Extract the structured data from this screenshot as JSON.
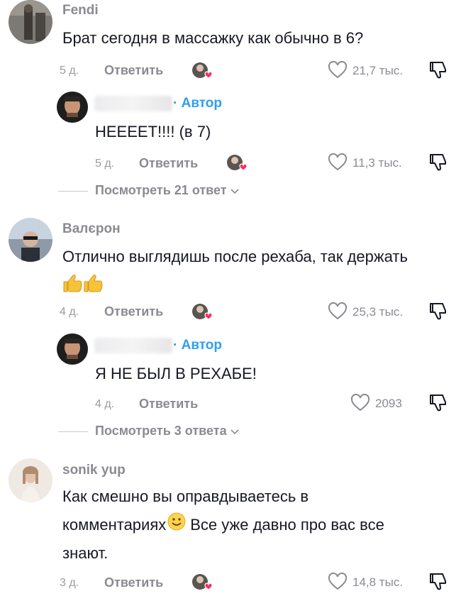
{
  "comments": [
    {
      "author": "Fendi",
      "text": "Брат сегодня в массажку как обычно в 6?",
      "date": "5 д.",
      "reply_label": "Ответить",
      "likes": "21,7 тыс.",
      "reply": {
        "author_tag": "· Автор",
        "text": "НЕЕЕЕТ!!!! (в 7)",
        "date": "5 д.",
        "reply_label": "Ответить",
        "likes": "11,3 тыс."
      },
      "view_replies": "Посмотреть 21 ответ"
    },
    {
      "author": "Валєрон",
      "text": "Отлично выглядишь после рехаба, так держать",
      "date": "4 д.",
      "reply_label": "Ответить",
      "likes": "25,3 тыс.",
      "reply": {
        "author_tag": "· Автор",
        "text": "Я НЕ БЫЛ В РЕХАБЕ!",
        "date": "4 д.",
        "reply_label": "Ответить",
        "likes": "2093"
      },
      "view_replies": "Посмотреть 3 ответа"
    },
    {
      "author": "sonik yup",
      "text_line1": "Как смешно вы оправдываетесь в",
      "text_line2a": "комментариях",
      "text_line2b": "Все уже давно про вас все",
      "text_line3": "знают.",
      "date": "3 д.",
      "reply_label": "Ответить",
      "likes": "14,8 тыс."
    }
  ],
  "colors": {
    "author_tag": "#2f9ff0",
    "secondary_text": "#8a8b91",
    "heart_badge": "#fe2c55"
  }
}
